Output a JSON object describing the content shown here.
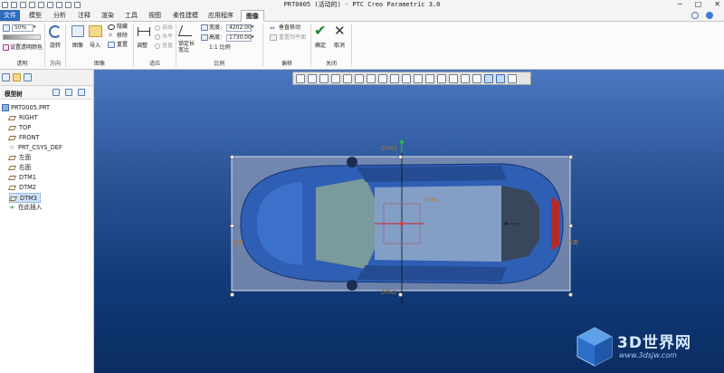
{
  "window": {
    "title": "PRT0005 (活动的) - PTC Creo Parametric 3.0",
    "controls": [
      "─",
      "□",
      "✕"
    ]
  },
  "menu": {
    "tabs": [
      "文件",
      "模型",
      "分析",
      "注释",
      "渲染",
      "工具",
      "视图",
      "柔性建模",
      "应用程序",
      "图像"
    ],
    "active_tab": "图像"
  },
  "ribbon": {
    "transparency": {
      "value": "50%",
      "set_color": "设置透明颜色",
      "label": "透明"
    },
    "direction": {
      "rotate": "旋转",
      "label": "方向"
    },
    "image": {
      "fit": "图像",
      "import": "导入",
      "hide": "隐藏",
      "remove": "移除",
      "reset": "重置",
      "label": "图像"
    },
    "fit": {
      "adjust": "调整",
      "free": "自由",
      "horizontal": "水平",
      "vertical": "竖直",
      "label": "适应"
    },
    "scale": {
      "lock_ratio": "锁定长宽比",
      "width_label": "宽度:",
      "width_value": "4202.00",
      "height_label": "高度:",
      "height_value": "1730.00",
      "ratio": "1:1 比例",
      "label": "比例"
    },
    "offset": {
      "vertical_move": "垂直移动",
      "reset_to_plane": "重置到平面",
      "label": "偏移"
    },
    "close": {
      "ok": "确定",
      "cancel": "取消",
      "label": "关闭"
    }
  },
  "model_tree": {
    "header": "模型树",
    "items": [
      {
        "label": "PRT0005.PRT",
        "type": "part"
      },
      {
        "label": "RIGHT",
        "type": "plane"
      },
      {
        "label": "TOP",
        "type": "plane"
      },
      {
        "label": "FRONT",
        "type": "plane"
      },
      {
        "label": "PRT_CSYS_DEF",
        "type": "csys"
      },
      {
        "label": "左面",
        "type": "plane"
      },
      {
        "label": "右面",
        "type": "plane"
      },
      {
        "label": "DTM1",
        "type": "plane"
      },
      {
        "label": "DTM2",
        "type": "plane"
      },
      {
        "label": "DTM3",
        "type": "plane",
        "selected": true
      },
      {
        "label": "在此插入",
        "type": "insert"
      }
    ]
  },
  "viewport": {
    "datum_labels": [
      "DTM3",
      "DTM1",
      "右面",
      "左面",
      "DTM2"
    ]
  },
  "watermark": {
    "brand": "3D世界网",
    "url": "www.3dsjw.com"
  },
  "colors": {
    "file_tab": "#2d6cc0",
    "ok_green": "#1a8c2e",
    "cancel_dark": "#333333",
    "selection": "#cfe3fb"
  }
}
